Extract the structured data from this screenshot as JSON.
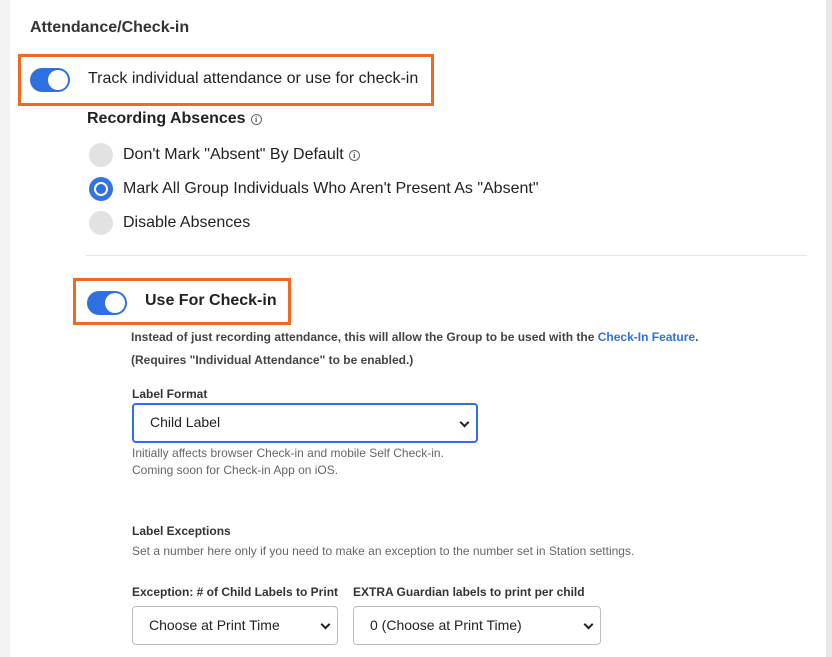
{
  "section": {
    "title": "Attendance/Check-in"
  },
  "track_attendance": {
    "label": "Track individual attendance or use for check-in",
    "enabled": true
  },
  "recording_absences": {
    "heading": "Recording Absences",
    "options": [
      {
        "label": "Don't Mark \"Absent\" By Default",
        "selected": false,
        "info": true
      },
      {
        "label": "Mark All Group Individuals Who Aren't Present As \"Absent\"",
        "selected": true
      },
      {
        "label": "Disable Absences",
        "selected": false
      }
    ]
  },
  "check_in": {
    "label": "Use For Check-in",
    "enabled": true,
    "description_prefix": "Instead of just recording attendance, this will allow the Group to be used with the",
    "description_link": "Check-In Feature",
    "description_suffix": ".",
    "requirement": "(Requires \"Individual Attendance\" to be enabled.)"
  },
  "label_format": {
    "label": "Label Format",
    "value": "Child Label",
    "note_line1": "Initially affects browser Check-in and mobile Self Check-in.",
    "note_line2": "Coming soon for Check-in App on iOS."
  },
  "label_exceptions": {
    "heading": "Label Exceptions",
    "description": "Set a number here only if you need to make an exception to the number set in Station settings.",
    "child_labels": {
      "label": "Exception: # of Child Labels to Print",
      "value": "Choose at Print Time"
    },
    "guardian_labels": {
      "label": "EXTRA Guardian labels to print per child",
      "value": "0 (Choose at Print Time)"
    }
  },
  "colors": {
    "accent": "#2f6fe0",
    "highlight": "#f26722",
    "link": "#2f72d6"
  },
  "icons": [
    "info-icon",
    "chevron-down-icon"
  ]
}
